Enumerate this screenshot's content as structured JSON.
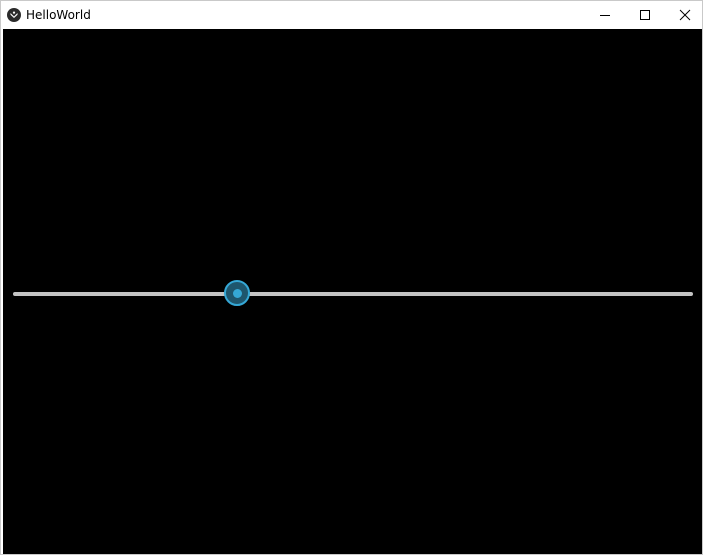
{
  "window": {
    "title": "HelloWorld",
    "app_icon": "kivy-logo-icon",
    "controls": {
      "minimize_icon": "minimize-icon",
      "maximize_icon": "maximize-icon",
      "close_icon": "close-icon"
    }
  },
  "client": {
    "background": "#000000"
  },
  "slider": {
    "value_fraction": 0.33,
    "track_color": "#c4c4c4",
    "thumb_color": "#35a8d6"
  }
}
